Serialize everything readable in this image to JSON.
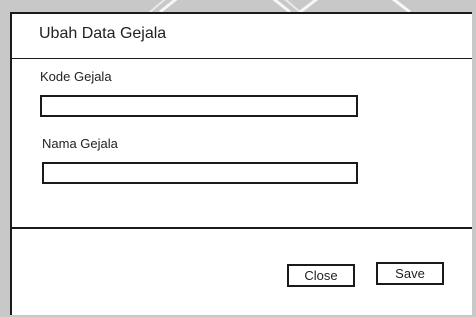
{
  "dialog": {
    "title": "Ubah Data Gejala"
  },
  "form": {
    "kode_label": "Kode Gejala",
    "kode_value": "",
    "nama_label": "Nama Gejala",
    "nama_value": ""
  },
  "footer": {
    "close_label": "Close",
    "save_label": "Save"
  },
  "colors": {
    "page_background": "#c8c8c8",
    "dialog_background": "#ffffff",
    "border": "#1a1a1a"
  }
}
